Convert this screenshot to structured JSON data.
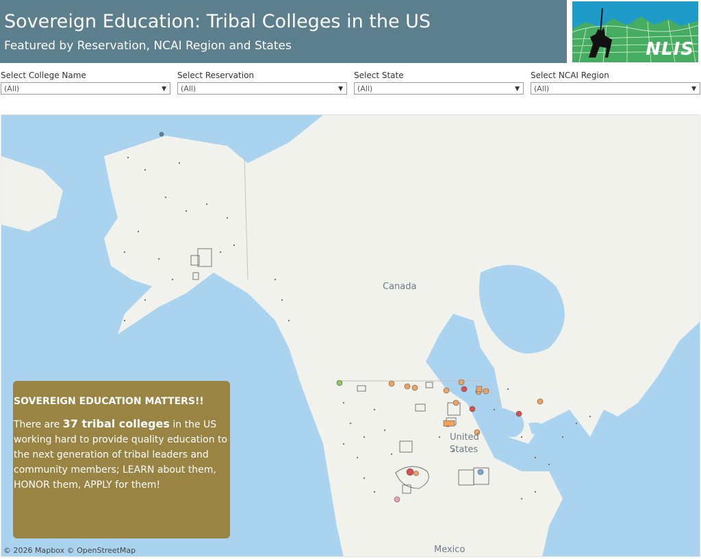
{
  "header": {
    "title": "Sovereign Education: Tribal Colleges in the US",
    "subtitle": "Featured by Reservation, NCAI Region and States",
    "logo_text": "NLIS"
  },
  "filters": [
    {
      "label": "Select College Name",
      "value": "(All)"
    },
    {
      "label": "Select Reservation",
      "value": "(All)"
    },
    {
      "label": "Select State",
      "value": "(All)"
    },
    {
      "label": "Select NCAI Region",
      "value": "(All)"
    }
  ],
  "map": {
    "labels": {
      "canada": "Canada",
      "us_line1": "United",
      "us_line2": "States",
      "mexico": "Mexico"
    },
    "attribution": "© 2026 Mapbox  © OpenStreetMap",
    "colors": {
      "water": "#a9d3ee",
      "land": "#f2f2ec",
      "marker_orange": "#f0a35e",
      "marker_red": "#d94e4e",
      "marker_blue": "#7da7d9",
      "marker_green": "#8fc46a"
    }
  },
  "info_box": {
    "heading": "SOVEREIGN EDUCATION MATTERS!!",
    "body_pre": "There are ",
    "body_highlight": "37 tribal colleges",
    "body_post": " in the US working hard to provide quality education to the next generation of tribal leaders and community members; LEARN about them, HONOR them, APPLY for them!",
    "background": "#9a8444"
  }
}
